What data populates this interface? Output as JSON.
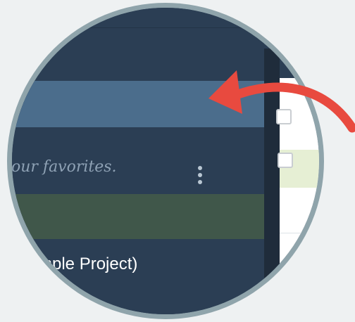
{
  "favorites_hint": "our favorites.",
  "project_label": "mple Project)",
  "colors": {
    "sidebar_bg": "#2b3e54",
    "selected_row_bg": "#4b6d8c",
    "active_row_bg": "#40574a",
    "hint_text": "#8ea1b4",
    "arrow": "#e84a3f",
    "lens_border": "#8fa4ab"
  },
  "icons": {
    "menu": "kebab-menu-icon",
    "pointer": "red-arrow-icon"
  }
}
